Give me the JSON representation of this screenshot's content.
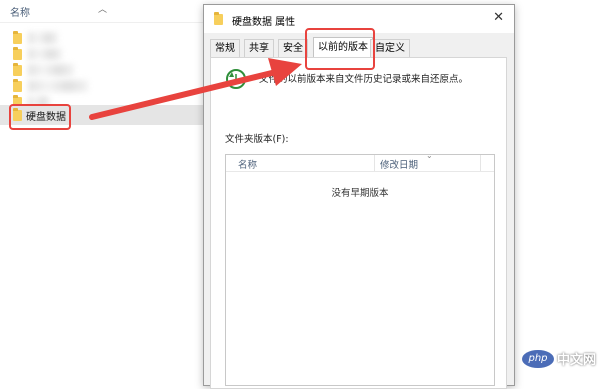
{
  "explorer": {
    "column_header": "名称",
    "selected_folder": "硬盘数据"
  },
  "dialog": {
    "title": "硬盘数据 属性",
    "close": "✕",
    "tabs": [
      {
        "label": "常规"
      },
      {
        "label": "共享"
      },
      {
        "label": "安全"
      },
      {
        "label": "以前的版本",
        "active": true
      },
      {
        "label": "自定义"
      }
    ],
    "description": "文件的以前版本来自文件历史记录或来自还原点。",
    "section_label": "文件夹版本(F):",
    "list_columns": [
      "名称",
      "修改日期"
    ],
    "empty_message": "没有早期版本"
  },
  "colors": {
    "annotation_red": "#e8433e",
    "folder_yellow": "#f7cf5c",
    "selection_gray": "#e5e5e5"
  },
  "watermark": {
    "logo_text": "php",
    "site_text": "中文网"
  }
}
